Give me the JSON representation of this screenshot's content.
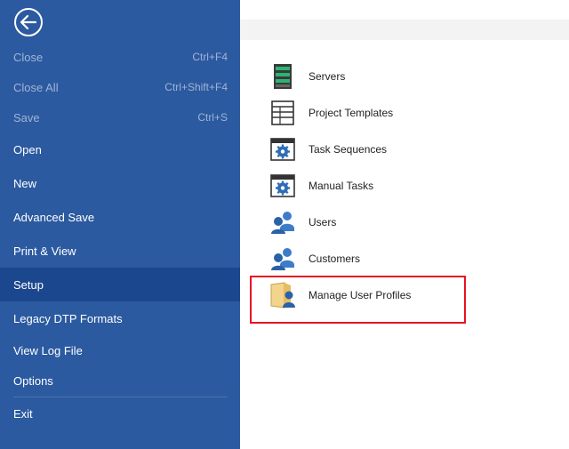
{
  "sidebar": {
    "items": [
      {
        "label": "Close",
        "shortcut": "Ctrl+F4",
        "disabled": true
      },
      {
        "label": "Close All",
        "shortcut": "Ctrl+Shift+F4",
        "disabled": true
      },
      {
        "label": "Save",
        "shortcut": "Ctrl+S",
        "disabled": true
      },
      {
        "label": "Open"
      },
      {
        "label": "New"
      },
      {
        "label": "Advanced Save"
      },
      {
        "label": "Print & View"
      },
      {
        "label": "Setup",
        "active": true
      },
      {
        "label": "Legacy DTP Formats"
      },
      {
        "label": "View Log File"
      },
      {
        "label": "Options"
      },
      {
        "label": "Exit"
      }
    ]
  },
  "setup": {
    "items": [
      {
        "label": "Servers",
        "icon": "server-icon"
      },
      {
        "label": "Project Templates",
        "icon": "template-icon"
      },
      {
        "label": "Task Sequences",
        "icon": "gear-window-icon"
      },
      {
        "label": "Manual Tasks",
        "icon": "gear-window-icon"
      },
      {
        "label": "Users",
        "icon": "users-icon"
      },
      {
        "label": "Customers",
        "icon": "users-icon"
      },
      {
        "label": "Manage User Profiles",
        "icon": "user-profile-icon"
      }
    ]
  },
  "colors": {
    "sidebar_bg": "#2c5aa0",
    "active_bg": "#1b478e",
    "highlight": "#e81123"
  }
}
